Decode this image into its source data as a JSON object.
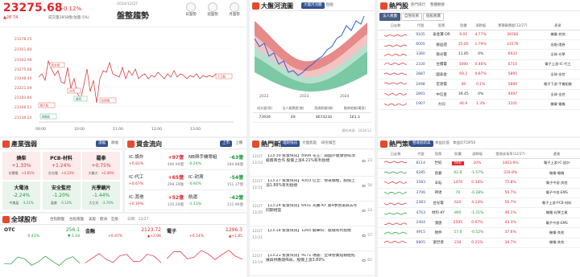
{
  "header": {
    "index_value": "23275.68",
    "change_pct": "+0.12%",
    "change_pts": "▲28.74",
    "volume": "成交量2858億(估量-5%)",
    "time": "2024/12/27",
    "trend_label": "盤整趨勢",
    "opts": [
      "日盤勢",
      "週盤勢",
      "月盤勢"
    ]
  },
  "intraday": {
    "y_ticks": [
      "23378.25",
      "23351.80",
      "23302.98",
      "23275.68",
      "23248.40",
      "23221.09",
      "23193.80",
      "23166.51",
      "23139.22"
    ],
    "x_ticks": [
      "09:00",
      "10:00",
      "11:00",
      "12:00",
      "13:00"
    ],
    "annotations": [
      "新台幣",
      "外資",
      "櫃買",
      "電子股",
      "金融股",
      "台積電",
      "千元股"
    ]
  },
  "industry": {
    "title": "產業強弱",
    "btns": [
      "漲幅",
      "跌幅"
    ],
    "cards": [
      {
        "name": "燒柴",
        "pct": "+1.33%",
        "sub": "台積電",
        "subpct": "+3.65%"
      },
      {
        "name": "PCB-材料",
        "pct": "+1.24%",
        "sub": "台光電",
        "subpct": "+4.23%"
      },
      {
        "name": "羅拳",
        "pct": "+0.75%",
        "sub": "大聯大",
        "subpct": "+2.49%"
      },
      {
        "name": "大電池",
        "pct": "-2.24%",
        "sub": "中美晶",
        "subpct": "-3.21%"
      },
      {
        "name": "安全監控",
        "pct": "-1.20%",
        "sub": "晶睿",
        "subpct": "-5.12%"
      },
      {
        "name": "光學鏡片",
        "pct": "-1.44%",
        "sub": "大立光",
        "subpct": "-3.70%"
      }
    ]
  },
  "flow": {
    "title": "資金流向",
    "btns": [
      "上市",
      "上櫃"
    ],
    "cards": [
      {
        "name": "IC-設計",
        "val": "+97億",
        "pct": "+0.81%",
        "sub": "490.90億"
      },
      {
        "name": "NB與手機零組",
        "val": "-63億",
        "pct": "-0.24%",
        "sub": "284.88億"
      },
      {
        "name": "IC-代工",
        "val": "+65億",
        "pct": "+0.67%",
        "sub": "299.39億"
      },
      {
        "name": "IC-封測",
        "val": "-54億",
        "pct": "-0.92%",
        "sub": "151.37億"
      },
      {
        "name": "IC-其他",
        "val": "+52億",
        "pct": "+0.19%",
        "sub": "135.29億"
      },
      {
        "name": "航運",
        "val": "-42億",
        "pct": "-1.13%",
        "sub": "111.96億"
      }
    ]
  },
  "global": {
    "title": "全球股市",
    "tabs": [
      "台指期盤",
      "台指夜盤",
      "美股",
      "歐洲",
      "亞股",
      "日期：12/27"
    ],
    "cards": [
      {
        "name": "OTC",
        "val": "256.1",
        "chg": "-0.43%",
        "pts": "▼-1.18"
      },
      {
        "name": "金融",
        "val": "2123.72",
        "chg": "+0.47%",
        "pts": "▲+2.96"
      },
      {
        "name": "電子",
        "val": "1296.3",
        "chg": "+0.14%",
        "pts": "▲+1.85"
      }
    ]
  },
  "river": {
    "title": "大盤河流圖",
    "tabs": [
      "大盤河流圖",
      "個股"
    ],
    "x_labels": [
      "2022",
      "2023",
      "2024"
    ],
    "table_headers": [
      "成交量(張)",
      "法人買賣超(億)",
      "融資餘額(億)",
      "融券餘額(萬張)"
    ],
    "table_values": [
      "73939",
      "49",
      "8674230",
      "161.3"
    ],
    "note": "資料來源：2024/12"
  },
  "news": {
    "title": "熱門新聞",
    "tabs": [
      "理財快訊",
      "大盤焦點",
      "研究報告"
    ],
    "items": [
      {
        "date": "12/27",
        "time": "13:53",
        "text": "【13:30 投資快訊】8906 花王：與國外健康領域頂級廠商合作 股價上漲4.21%有利指標",
        "views": "23"
      },
      {
        "date": "12/27",
        "time": "13:51",
        "text": "【13:27 投資快訊】4303 信立：營運積極，股價上漲1.89%有利指標",
        "views": "50"
      },
      {
        "date": "12/27",
        "time": "13:25",
        "text": "【13:24 投資快訊】6431 光麗-KY 第4季營運與去年同期相當",
        "views": "23"
      },
      {
        "date": "12/27",
        "time": "13:21",
        "text": "【13:18 投資快訊】1265 龍華科：股價有利指標",
        "views": "57"
      },
      {
        "date": "12/27",
        "time": "13:19",
        "text": "【13:21 投資快訊】4171 瑞基：全球營業點積極拓展與供應鏈佈局，股價上漲3.89%",
        "views": "62"
      }
    ]
  },
  "hotstock": {
    "title": "熱門股",
    "tabs": [
      "熱門排行",
      "整體觀察"
    ],
    "subtabs": [
      "法人買賣",
      "自營商買",
      "個股買賣"
    ],
    "headers": [
      "日走勢",
      "代號",
      "股票",
      "股價",
      "漲跌幅",
      "累積買賣超(12/27)",
      "產業"
    ],
    "rows": [
      {
        "code": "9105",
        "name": "泰金寶-DR",
        "price": "9.01",
        "pct": "4.77%",
        "vol": "39782",
        "ind": "機電-其他"
      },
      {
        "code": "6005",
        "name": "群益證",
        "price": "25.85",
        "pct": "1.79%",
        "vol": "14176",
        "ind": "金融-證券"
      },
      {
        "code": "3380",
        "name": "微光電",
        "price": "11.85",
        "pct": "0%",
        "vol": "6932",
        "ind": "全球-光學"
      },
      {
        "code": "2330",
        "name": "台積電",
        "price": "1090",
        "pct": "0.46%",
        "vol": "6710",
        "ind": "電子上游-IC-代工"
      },
      {
        "code": "2887",
        "name": "國泰金",
        "price": "69.2",
        "pct": "0.87%",
        "vol": "5895",
        "ind": "全球-金控"
      },
      {
        "code": "2498",
        "name": "宏達電",
        "price": "49",
        "pct": "0.1%",
        "vol": "5890",
        "ind": "電子下游-手機組裝"
      },
      {
        "code": "2891",
        "name": "中信金",
        "price": "39.45",
        "pct": "0%",
        "vol": "4097",
        "ind": "全球-金控"
      },
      {
        "code": "1907",
        "name": "大同",
        "price": "46.9",
        "pct": "1.3%",
        "vol": "3101",
        "ind": "機電-電機"
      }
    ]
  },
  "strategy": {
    "title": "熱門策略",
    "tabs": [
      "營收創新高",
      "本益比低",
      "本益比TOP50"
    ],
    "headers": [
      "日走勢",
      "代號",
      "股票",
      "股價",
      "漲跌幅",
      "營收成長率(12/27)",
      "產業"
    ],
    "rows": [
      {
        "code": "8114",
        "name": "世紀",
        "price": "660",
        "pct": "10%",
        "growth": "1403.9%",
        "ind": "電子上游-IC-設計"
      },
      {
        "code": "6285",
        "name": "啟碁",
        "price": "62.8",
        "pct": "-1.57%",
        "growth": "319.8%",
        "ind": "機電-電機"
      },
      {
        "code": "3583",
        "name": "辛耘",
        "price": "1470",
        "pct": "0.34%",
        "growth": "75.8%",
        "ind": "電子中游-其他"
      },
      {
        "code": "3706",
        "name": "神達",
        "price": "70",
        "pct": "-0.28%",
        "growth": "59.7%",
        "ind": "電子中游-EMS"
      },
      {
        "code": "2383",
        "name": "台光電",
        "price": "620",
        "pct": "4.13%",
        "growth": "56.7%",
        "ind": "電子上游-PCB-材料"
      },
      {
        "code": "4763",
        "name": "材料-KY",
        "price": "895",
        "pct": "-1.21%",
        "growth": "46.1%",
        "ind": "機電-化學工業"
      },
      {
        "code": "2404",
        "name": "漢唐",
        "price": "2595",
        "pct": "0.97%",
        "growth": "43.3%",
        "ind": "電子中游-EMS"
      },
      {
        "code": "4915",
        "name": "致伸",
        "price": "57.6",
        "pct": "-0.52%",
        "growth": "37.6%",
        "ind": "機電-其他"
      },
      {
        "code": "6805",
        "name": "富世達",
        "price": "234",
        "pct": "0.21%",
        "growth": "34.7%",
        "ind": "機電-其他"
      }
    ]
  },
  "colors": {
    "up": "#e0282f",
    "down": "#1b9a3a",
    "navy": "#33528f"
  }
}
